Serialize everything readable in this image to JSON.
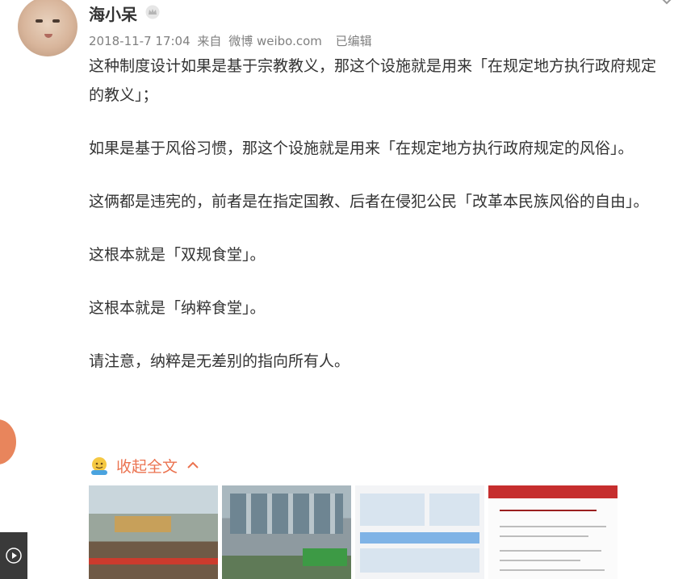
{
  "post": {
    "username": "海小呆",
    "timestamp": "2018-11-7 17:04",
    "source_prefix": "来自",
    "source": "微博 weibo.com",
    "edited": "已编辑",
    "paragraphs": [
      "这种制度设计如果是基于宗教教义，那这个设施就是用来「在规定地方执行政府规定的教义」；",
      "如果是基于风俗习惯，那这个设施就是用来「在规定地方执行政府规定的风俗」。",
      "这俩都是违宪的，前者是在指定国教、后者在侵犯公民「改革本民族风俗的自由」。",
      "这根本就是「双规食堂」。",
      "这根本就是「纳粹食堂」。",
      "请注意，纳粹是无差别的指向所有人。"
    ],
    "collapse_label": "收起全文"
  },
  "colors": {
    "accent": "#eb7350",
    "meta_text": "#808080",
    "body_text": "#333333"
  },
  "icons": [
    "crown-icon",
    "chevron-down-icon",
    "emoji-icon",
    "chevron-up-icon",
    "play-icon"
  ]
}
